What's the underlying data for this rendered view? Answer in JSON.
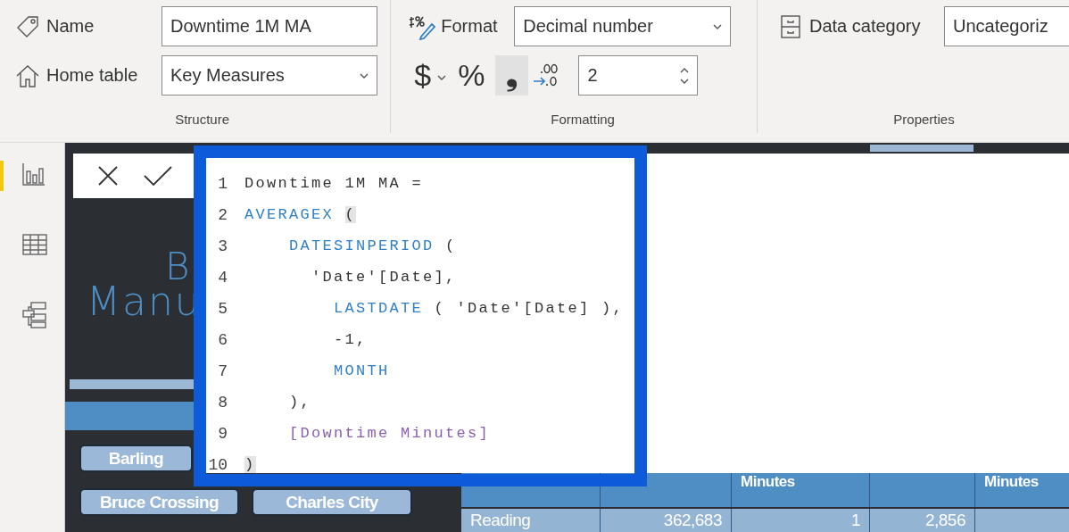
{
  "ribbon": {
    "groups": [
      {
        "kind": "structure",
        "label": "Structure",
        "name_label": "Name",
        "name_value": "Downtime 1M MA",
        "home_label": "Home table",
        "home_value": "Key Measures"
      },
      {
        "kind": "formatting",
        "label": "Formatting",
        "format_label": "Format",
        "format_value": "Decimal number",
        "currency": "$",
        "percent": "%",
        "comma": "❟",
        "comma_selected": true,
        "decimals": "2"
      },
      {
        "kind": "properties",
        "label": "Properties",
        "category_label": "Data category",
        "category_value": "Uncategoriz"
      }
    ]
  },
  "nav": [
    {
      "kind": "report",
      "selected": true
    },
    {
      "kind": "data",
      "selected": false
    },
    {
      "kind": "model",
      "selected": false
    }
  ],
  "report": {
    "title_parts": [
      "B",
      "Manu"
    ],
    "slicers": [
      {
        "label": "Barling"
      },
      {
        "label": "Bruce Crossing"
      },
      {
        "label": "Charles City"
      }
    ],
    "table": {
      "columns": [
        {
          "kind": "label"
        },
        {
          "kind": "number"
        },
        {
          "kind": "number",
          "header": "Minutes"
        },
        {
          "kind": "number"
        },
        {
          "kind": "number",
          "header": "Minutes"
        }
      ],
      "rows": [
        [
          "Reading",
          "362,683",
          "1",
          "2,856"
        ]
      ]
    }
  },
  "editor": {
    "lines": [
      {
        "number": "1",
        "segments": [
          {
            "kind": "text",
            "text": "Downtime 1M MA ="
          }
        ]
      },
      {
        "number": "2",
        "segments": [
          {
            "kind": "keyword",
            "text": "AVERAGEX "
          },
          {
            "kind": "match",
            "text": "("
          }
        ]
      },
      {
        "number": "3",
        "segments": [
          {
            "kind": "keyword",
            "text": "    DATESINPERIOD "
          },
          {
            "kind": "text",
            "text": "("
          }
        ]
      },
      {
        "number": "4",
        "segments": [
          {
            "kind": "text",
            "text": "      'Date'[Date],"
          }
        ]
      },
      {
        "number": "5",
        "segments": [
          {
            "kind": "keyword",
            "text": "        LASTDATE "
          },
          {
            "kind": "text",
            "text": "( 'Date'[Date] ),"
          }
        ]
      },
      {
        "number": "6",
        "segments": [
          {
            "kind": "text",
            "text": "        -1,"
          }
        ]
      },
      {
        "number": "7",
        "segments": [
          {
            "kind": "keyword",
            "text": "        MONTH"
          }
        ]
      },
      {
        "number": "8",
        "segments": [
          {
            "kind": "text",
            "text": "    ),"
          }
        ]
      },
      {
        "number": "9",
        "segments": [
          {
            "kind": "measure",
            "text": "    [Downtime Minutes]"
          }
        ]
      },
      {
        "number": "10",
        "segments": [
          {
            "kind": "match",
            "text": ")"
          }
        ]
      }
    ]
  }
}
